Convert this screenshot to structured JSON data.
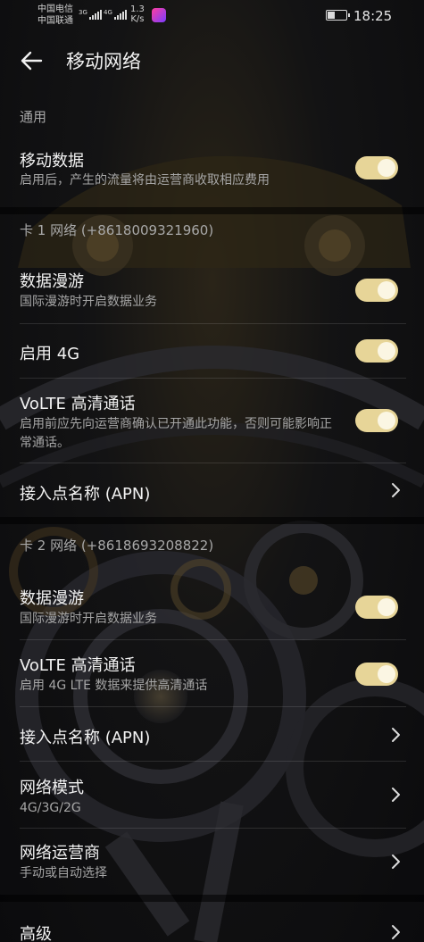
{
  "status_bar": {
    "carrier_1": "中国电信",
    "carrier_2": "中国联通",
    "sig1_tag": "3G",
    "sig2_tag": "4G",
    "net_speed_value": "1.3",
    "net_speed_unit": "K/s",
    "time": "18:25",
    "icons": [
      "signal-icon",
      "signal-icon",
      "app-icon",
      "battery-icon"
    ]
  },
  "header": {
    "back_icon": "back-arrow-icon",
    "title": "移动网络"
  },
  "general": {
    "section_label": "通用",
    "mobile_data": {
      "title": "移动数据",
      "subtitle": "启用后，产生的流量将由运营商收取相应费用",
      "enabled": true
    }
  },
  "sim1": {
    "section_label": "卡 1 网络 (+8618009321960)",
    "roaming": {
      "title": "数据漫游",
      "subtitle": "国际漫游时开启数据业务",
      "enabled": true
    },
    "enable_4g": {
      "title": "启用 4G",
      "enabled": true
    },
    "volte": {
      "title": "VoLTE 高清通话",
      "subtitle": "启用前应先向运营商确认已开通此功能，否则可能影响正常通话。",
      "enabled": true
    },
    "apn": {
      "title": "接入点名称 (APN)"
    }
  },
  "sim2": {
    "section_label": "卡 2 网络 (+8618693208822)",
    "roaming": {
      "title": "数据漫游",
      "subtitle": "国际漫游时开启数据业务",
      "enabled": true
    },
    "volte": {
      "title": "VoLTE 高清通话",
      "subtitle": "启用 4G LTE 数据来提供高清通话",
      "enabled": true
    },
    "apn": {
      "title": "接入点名称 (APN)"
    },
    "network_mode": {
      "title": "网络模式",
      "subtitle": "4G/3G/2G"
    },
    "carrier": {
      "title": "网络运营商",
      "subtitle": "手动或自动选择"
    }
  },
  "advanced": {
    "title": "高级"
  },
  "colors": {
    "toggle_on": "#e7d598",
    "background": "#0d0d10"
  }
}
